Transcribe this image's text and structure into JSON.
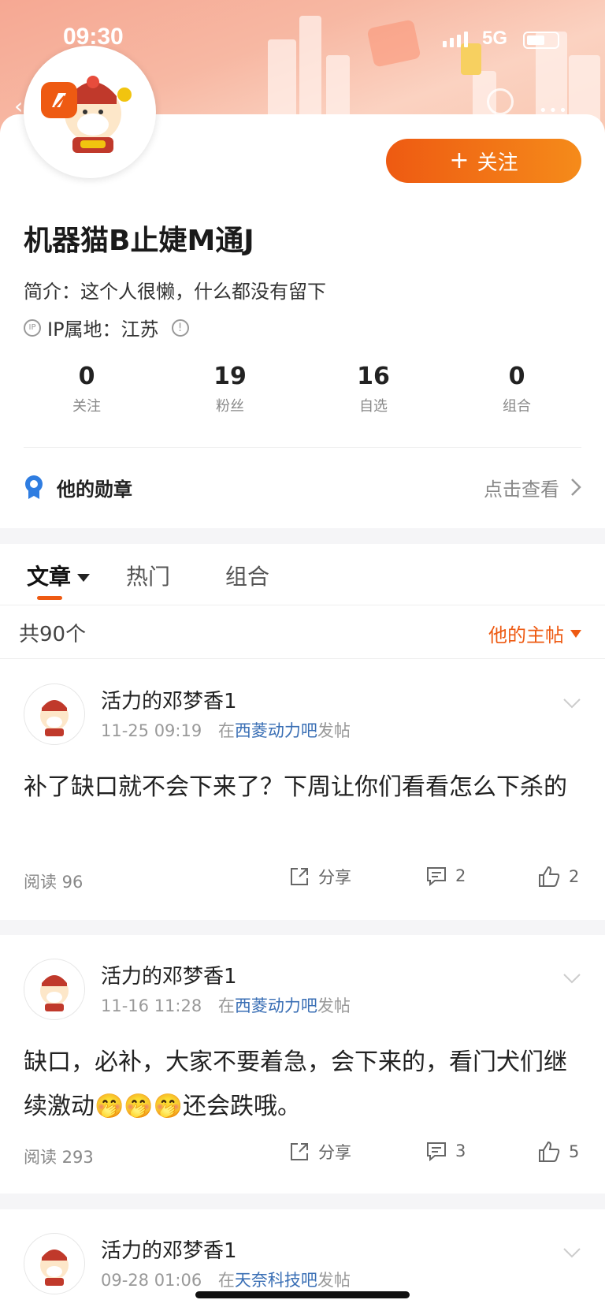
{
  "status": {
    "time": "09:30",
    "network": "5G"
  },
  "profile": {
    "follow_label": "关注",
    "name": "机器猫B止婕M通J",
    "bio": "简介：这个人很懒，什么都没有留下",
    "ip_badge": "IP",
    "ip": "IP属地：江苏",
    "stats": [
      {
        "num": "0",
        "label": "关注"
      },
      {
        "num": "19",
        "label": "粉丝"
      },
      {
        "num": "16",
        "label": "自选"
      },
      {
        "num": "0",
        "label": "组合"
      }
    ],
    "medal_label": "他的勋章",
    "medal_view": "点击查看"
  },
  "tabs": [
    "文章",
    "热门",
    "组合"
  ],
  "list": {
    "count": "共90个",
    "filter": "他的主帖"
  },
  "posts": [
    {
      "author": "活力的邓梦香1",
      "time": "11-25 09:19",
      "in": "在",
      "bar": "西菱动力吧",
      "post_suffix": "发帖",
      "content": "补了缺口就不会下来了？下周让你们看看怎么下杀的",
      "reads": "阅读 96",
      "share": "分享",
      "comments": "2",
      "likes": "2"
    },
    {
      "author": "活力的邓梦香1",
      "time": "11-16 11:28",
      "in": "在",
      "bar": "西菱动力吧",
      "post_suffix": "发帖",
      "content": "缺口，必补，大家不要着急，会下来的，看门犬们继续激动🤭🤭🤭还会跌哦。",
      "reads": "阅读 293",
      "share": "分享",
      "comments": "3",
      "likes": "5"
    },
    {
      "author": "活力的邓梦香1",
      "time": "09-28 01:06",
      "in": "在",
      "bar": "天奈科技吧",
      "post_suffix": "发帖"
    }
  ],
  "colors": {
    "accent": "#ee5a12",
    "link": "#3a6fb5",
    "banner": "#f6a893"
  }
}
